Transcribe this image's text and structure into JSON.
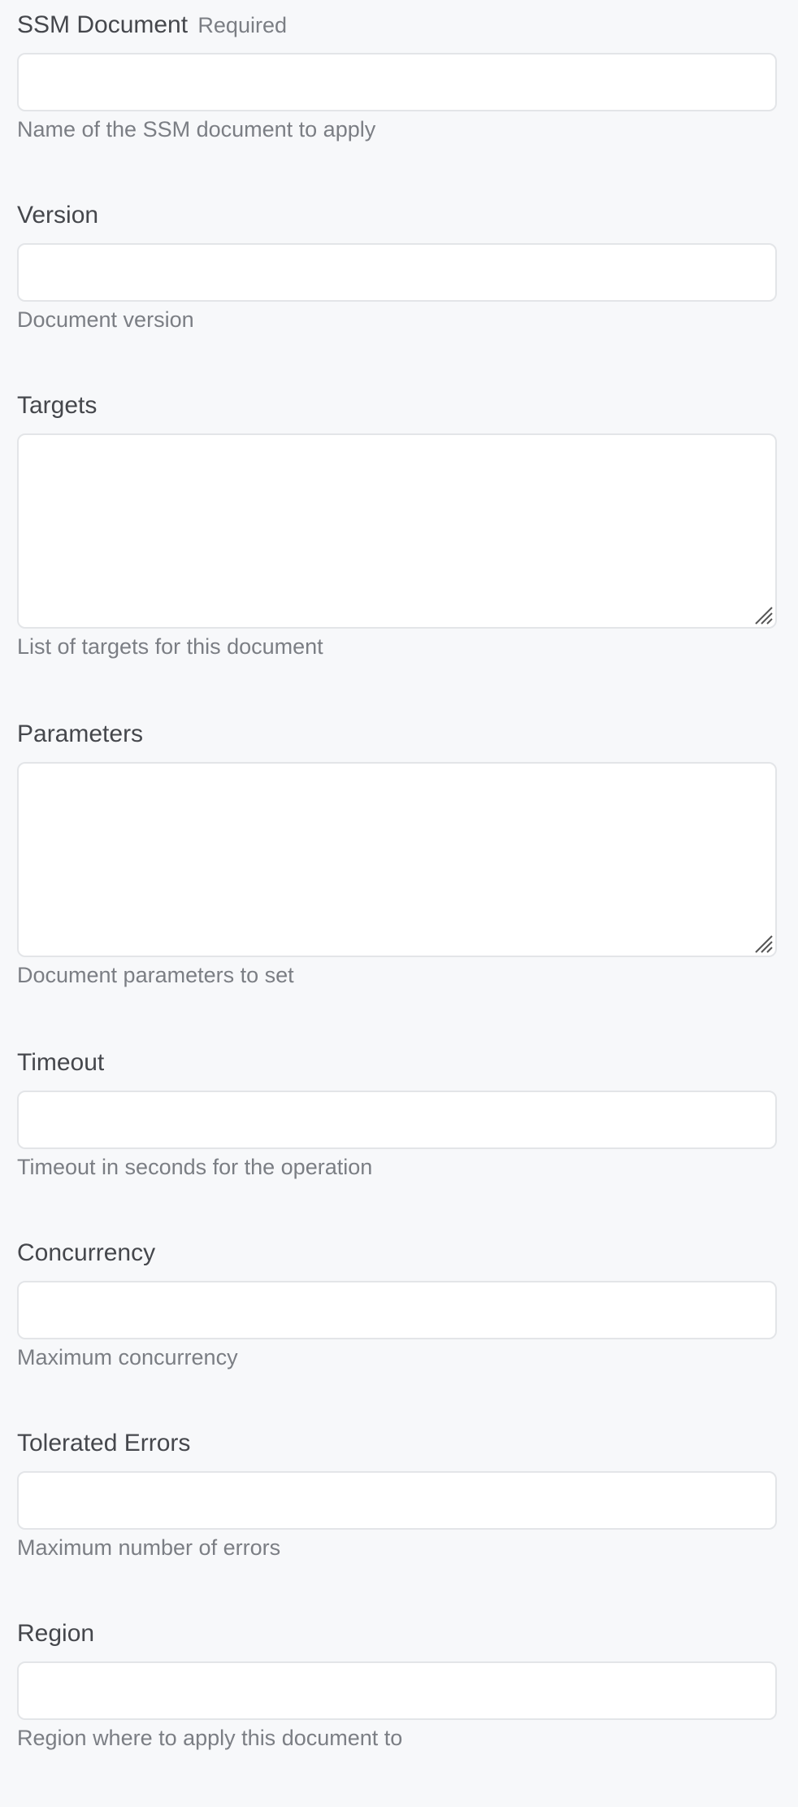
{
  "fields": [
    {
      "label": "SSM Document",
      "required_label": "Required",
      "value": "",
      "placeholder": "",
      "help": "Name of the SSM document to apply"
    },
    {
      "label": "Version",
      "value": "",
      "placeholder": "",
      "help": "Document version"
    },
    {
      "label": "Targets",
      "value": "",
      "placeholder": "",
      "help": "List of targets for this document"
    },
    {
      "label": "Parameters",
      "value": "",
      "placeholder": "",
      "help": "Document parameters to set"
    },
    {
      "label": "Timeout",
      "value": "",
      "placeholder": "",
      "help": "Timeout in seconds for the operation"
    },
    {
      "label": "Concurrency",
      "value": "",
      "placeholder": "",
      "help": "Maximum concurrency"
    },
    {
      "label": "Tolerated Errors",
      "value": "",
      "placeholder": "",
      "help": "Maximum number of errors"
    },
    {
      "label": "Region",
      "value": "",
      "placeholder": "",
      "help": "Region where to apply this document to"
    }
  ],
  "icons": {
    "resize_handle": "resize-grip-icon"
  },
  "colors": {
    "background": "#f7f8fa",
    "input_border": "#e3e5e8",
    "label": "#45474c",
    "help": "#7b7e84"
  }
}
